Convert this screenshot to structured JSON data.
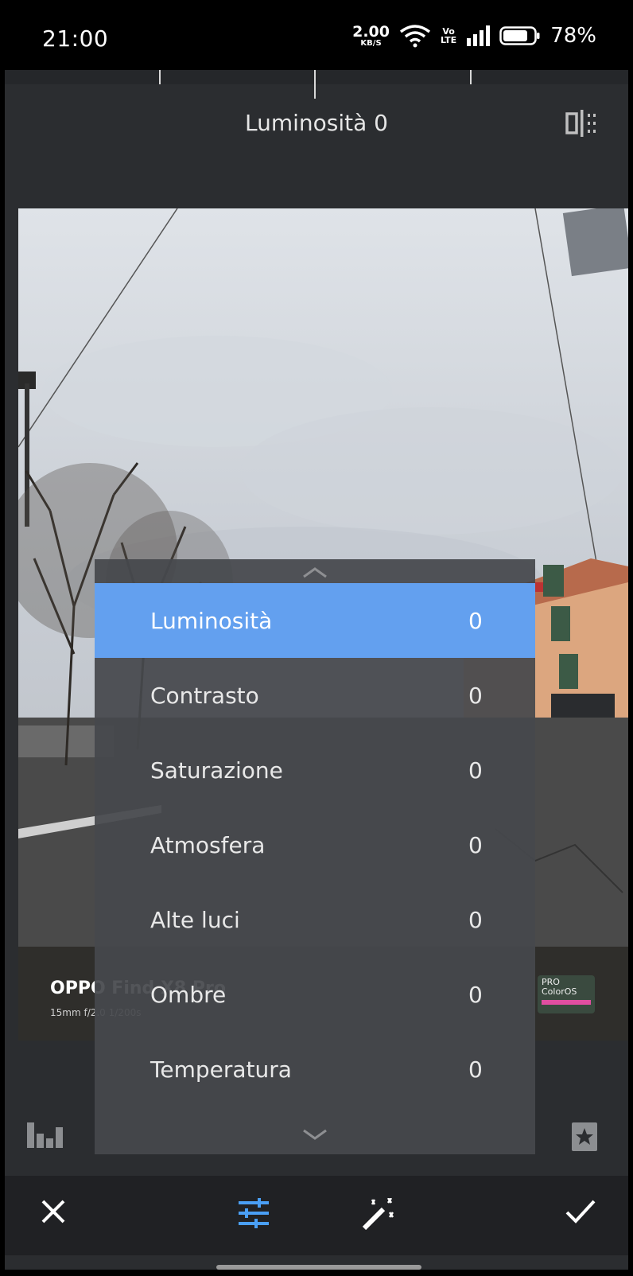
{
  "status_bar": {
    "time": "21:00",
    "net_speed_value": "2.00",
    "net_speed_unit": "KB/S",
    "volte_top": "Vo",
    "volte_bottom": "LTE",
    "battery_percent": "78%"
  },
  "header": {
    "title": "Luminosità 0"
  },
  "photo": {
    "watermark_title": "OPPO Find X8 Pro",
    "watermark_details": "15mm  f/2.0  1/200s",
    "badge_top": "PRO",
    "badge_bottom": "ColorOS"
  },
  "menu": {
    "items": [
      {
        "label": "Luminosità",
        "value": "0",
        "selected": true
      },
      {
        "label": "Contrasto",
        "value": "0"
      },
      {
        "label": "Saturazione",
        "value": "0"
      },
      {
        "label": "Atmosfera",
        "value": "0"
      },
      {
        "label": "Alte luci",
        "value": "0"
      },
      {
        "label": "Ombre",
        "value": "0"
      },
      {
        "label": "Temperatura",
        "value": "0"
      }
    ]
  },
  "toolbar": {
    "icons": [
      "close-icon",
      "sliders-icon",
      "magic-wand-icon",
      "check-icon"
    ],
    "active_color": "#4a9ff5"
  },
  "colors": {
    "selected_item": "#63a0ef",
    "background": "#2b2d30"
  }
}
